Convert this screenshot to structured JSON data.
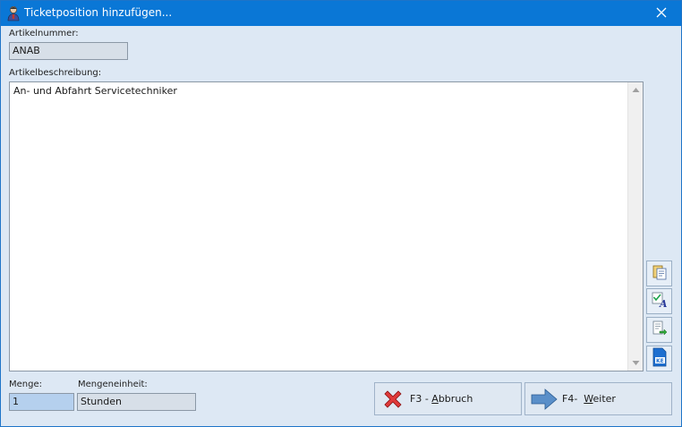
{
  "window": {
    "title": "Ticketposition hinzufügen...",
    "accent_color": "#0a77d6",
    "icon": "user-icon"
  },
  "artikelnummer": {
    "label": "Artikelnummer:",
    "value": "ANAB"
  },
  "artikelbeschreibung": {
    "label": "Artikelbeschreibung:",
    "value": "An- und Abfahrt Servicetechniker"
  },
  "side_buttons": [
    {
      "icon": "copy-clipboard-icon"
    },
    {
      "icon": "spellcheck-icon"
    },
    {
      "icon": "insert-text-icon"
    },
    {
      "icon": "text-block-icon"
    }
  ],
  "menge": {
    "label": "Menge:",
    "value": "1"
  },
  "mengeneinheit": {
    "label": "Mengeneinheit:",
    "value": "Stunden"
  },
  "buttons": {
    "cancel": {
      "prefix": "F3 - ",
      "mnemonic": "A",
      "rest": "bbruch"
    },
    "next": {
      "prefix": "F4-  ",
      "mnemonic": "W",
      "rest": "eiter"
    }
  }
}
